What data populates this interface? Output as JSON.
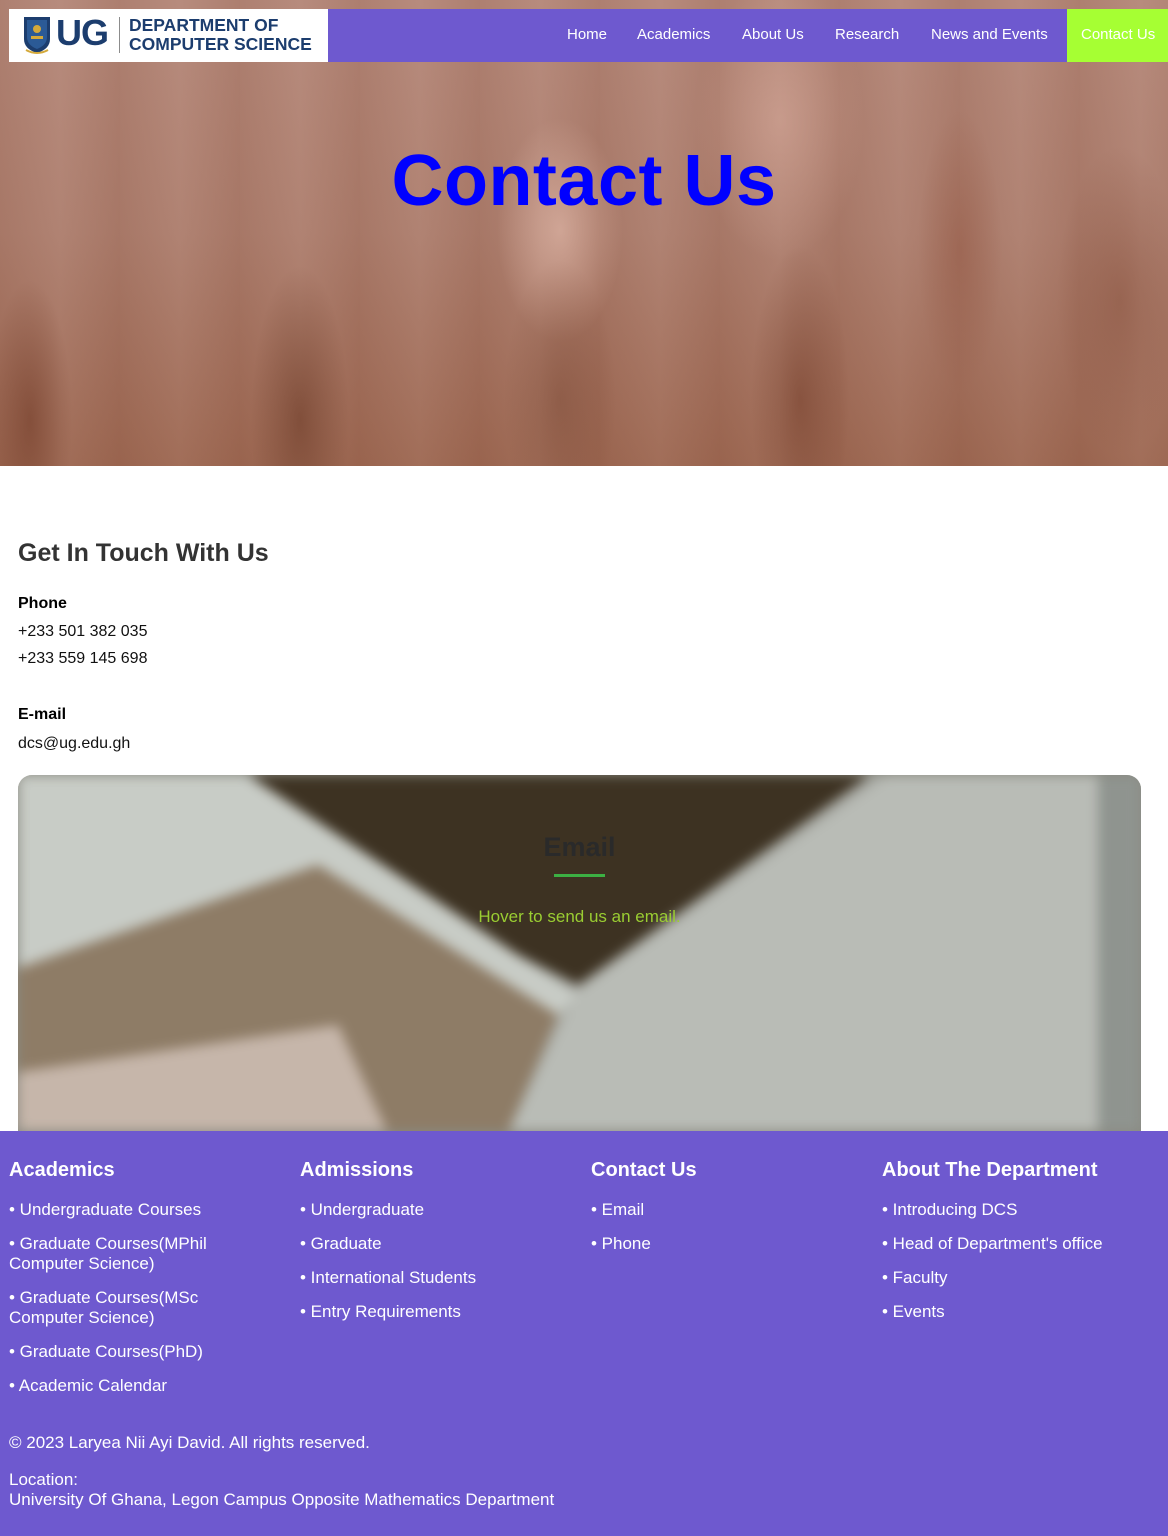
{
  "nav": {
    "logo_letters": "UG",
    "dept_line1": "DEPARTMENT OF",
    "dept_line2": "COMPUTER SCIENCE",
    "items": [
      "Home",
      "Academics",
      "About Us",
      "Research",
      "News and Events",
      "Contact Us"
    ],
    "active": "Contact Us"
  },
  "hero": {
    "title": "Contact Us"
  },
  "contact": {
    "heading": "Get In Touch With Us",
    "phone_label": "Phone",
    "phones": [
      "+233 501 382 035",
      "+233 559 145 698"
    ],
    "email_label": "E-mail",
    "email": "dcs@ug.edu.gh"
  },
  "email_card": {
    "title": "Email",
    "subtitle": "Hover to send us an email."
  },
  "footer": {
    "columns": [
      {
        "title": "Academics",
        "items": [
          "• Undergraduate Courses",
          "• Graduate Courses(MPhil Computer Science)",
          "• Graduate Courses(MSc Computer Science)",
          "• Graduate Courses(PhD)",
          "• Academic Calendar"
        ]
      },
      {
        "title": "Admissions",
        "items": [
          "• Undergraduate",
          "• Graduate",
          "• International Students",
          "• Entry Requirements"
        ]
      },
      {
        "title": "Contact Us",
        "items": [
          "• Email",
          "• Phone"
        ]
      },
      {
        "title": "About The Department",
        "items": [
          "• Introducing DCS",
          "• Head of Department's office",
          "• Faculty",
          "• Events"
        ]
      }
    ],
    "copyright": "© 2023 Laryea Nii Ayi David. All rights reserved.",
    "location_label": "Location:",
    "location": "University Of Ghana, Legon Campus Opposite Mathematics Department"
  },
  "colors": {
    "nav_bg": "#6e59cf",
    "active_nav_bg": "#a6ff33",
    "hero_title": "#0000ff",
    "card_subtitle": "#9acd32",
    "card_underline": "#3cb043"
  },
  "icons": {
    "logo": "university-crest-icon"
  }
}
